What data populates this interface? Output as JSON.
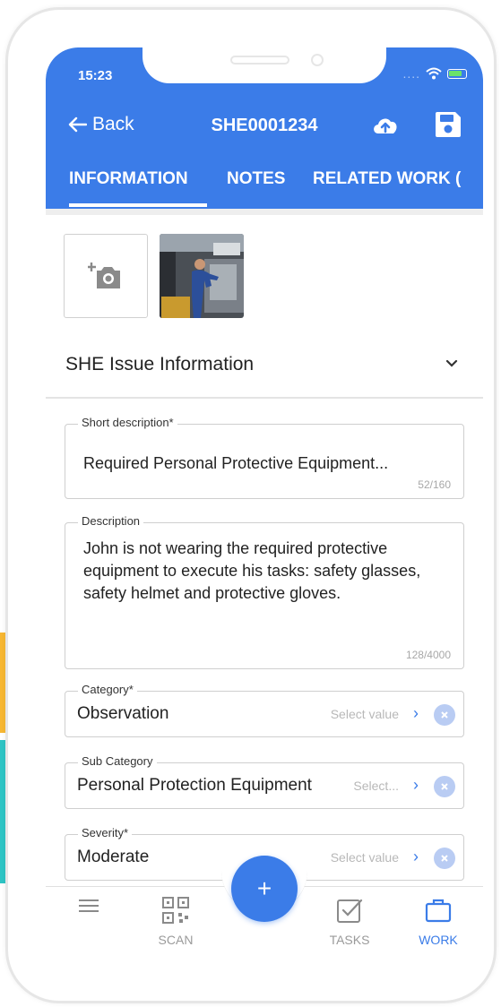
{
  "status_bar": {
    "time": "15:23",
    "signal_dots": "...."
  },
  "header": {
    "back_label": "Back",
    "title": "SHE0001234",
    "upload_icon": "cloud-upload-icon",
    "save_icon": "floppy-save-icon"
  },
  "tabs": [
    {
      "label": "INFORMATION",
      "active": true
    },
    {
      "label": "NOTES",
      "active": false
    },
    {
      "label": "RELATED WORK (",
      "active": false
    }
  ],
  "photos": {
    "add_icon": "add-photo-camera-icon"
  },
  "section": {
    "title": "SHE Issue Information",
    "icon": "chevron-down-icon"
  },
  "fields": {
    "short_description": {
      "label": "Short description*",
      "value": "Required Personal Protective Equipment...",
      "count": "52/160"
    },
    "description": {
      "label": "Description",
      "value": "John is not wearing the required protective equipment to execute his tasks: safety glasses, safety helmet and protective gloves.",
      "count": "128/4000"
    },
    "category": {
      "label": "Category*",
      "value": "Observation",
      "select_hint": "Select value"
    },
    "sub_category": {
      "label": "Sub Category",
      "value": "Personal Protection Equipment",
      "select_hint": "Select..."
    },
    "severity": {
      "label": "Severity*",
      "value": "Moderate",
      "select_hint": "Select value"
    }
  },
  "bottom_nav": [
    {
      "label": "",
      "icon": "menu-icon",
      "active": false
    },
    {
      "label": "SCAN",
      "icon": "qr-code-icon",
      "active": false
    },
    {
      "label": "TASKS",
      "icon": "checkbox-icon",
      "active": false
    },
    {
      "label": "WORK",
      "icon": "briefcase-icon",
      "active": true
    }
  ],
  "fab": {
    "label": "+"
  },
  "colors": {
    "primary": "#3b7ce8",
    "accent_yellow": "#f7b733",
    "accent_teal": "#2ec4c4"
  }
}
